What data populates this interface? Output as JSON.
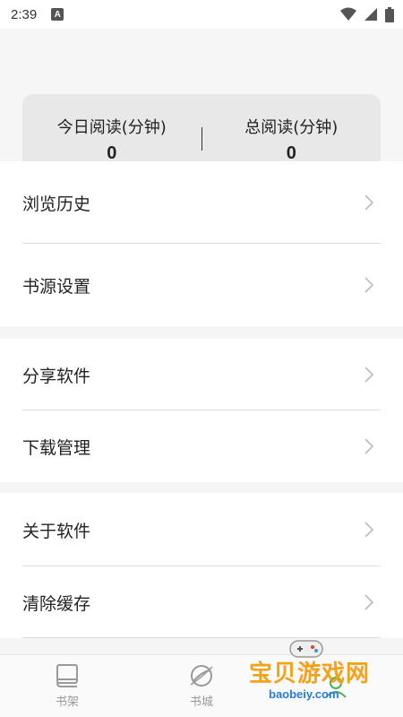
{
  "status": {
    "time": "2:39",
    "notif": "A"
  },
  "stats": {
    "today_label": "今日阅读(分钟)",
    "today_value": "0",
    "total_label": "总阅读(分钟)",
    "total_value": "0"
  },
  "menu": {
    "group1": [
      "浏览历史",
      "书源设置"
    ],
    "group2": [
      "分享软件",
      "下载管理"
    ],
    "group3": [
      "关于软件",
      "清除缓存"
    ]
  },
  "nav": {
    "bookshelf": "书架",
    "bookstore": "书城"
  },
  "watermark": {
    "text": "宝贝游戏网",
    "url": "baobeiy.com"
  }
}
